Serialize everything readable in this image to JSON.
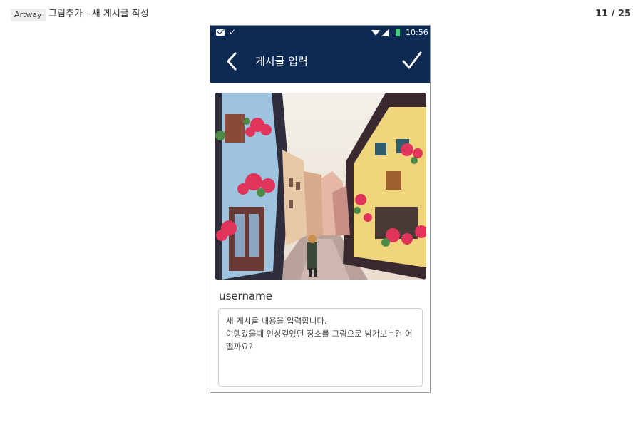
{
  "slide": {
    "tag": "Artway",
    "title": "그림추가 - 새 게시글 작성",
    "page": "11 / 25"
  },
  "status_bar": {
    "time": "10:56",
    "icons": [
      "mail-icon",
      "check-icon",
      "wifi-icon",
      "signal-icon",
      "battery-icon"
    ],
    "battery_color": "#3fd07a"
  },
  "app_bar": {
    "title": "게시글 입력",
    "back_icon": "chevron-left-icon",
    "confirm_icon": "checkmark-icon",
    "background": "#0d2a52"
  },
  "post": {
    "image": "painted-street-illustration",
    "username": "username",
    "content": "새 게시글 내용을 입력합니다.\n여행갔을때 인상깊었던 장소를 그림으로 남겨보는건 어떨까요?"
  }
}
